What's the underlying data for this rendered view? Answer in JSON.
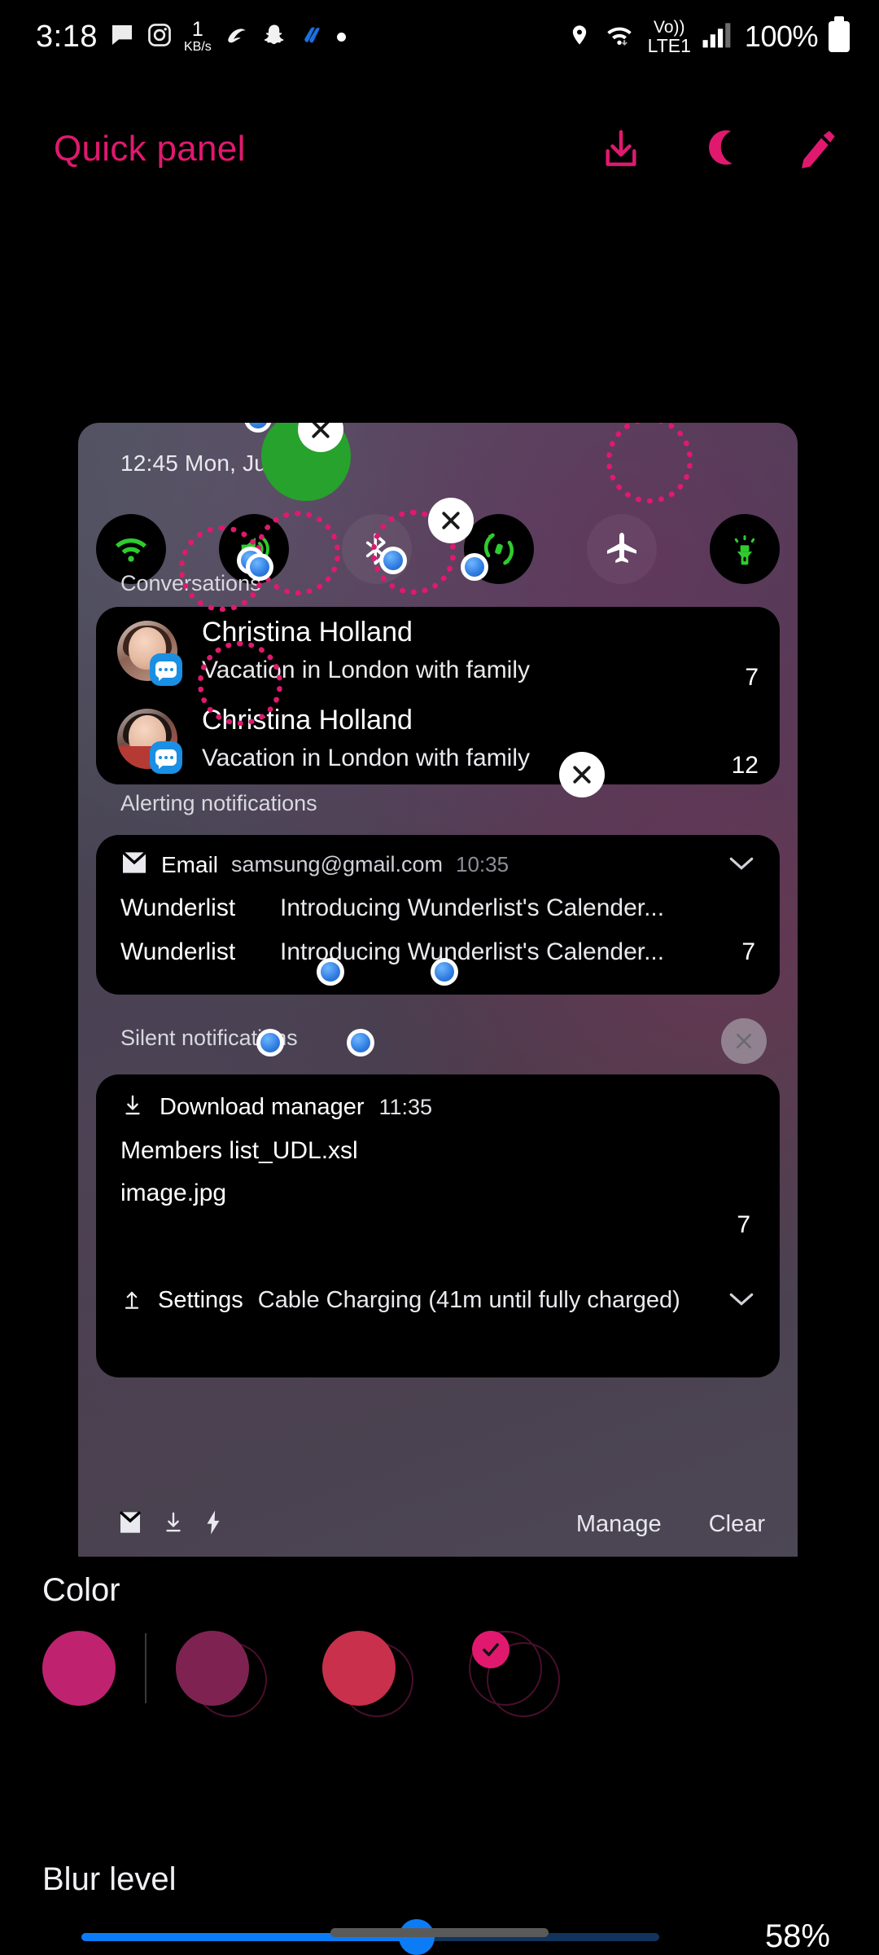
{
  "status_bar": {
    "time": "3:18",
    "left_icons": [
      "messages-icon",
      "instagram-icon",
      "data-speed-icon",
      "airtel-icon",
      "snapchat-icon",
      "jio-icon",
      "dot-icon"
    ],
    "data_speed_value": "1",
    "data_speed_unit": "KB/s",
    "right_icons": [
      "location-icon",
      "wifi-icon",
      "volte-icon",
      "signal-icon",
      "battery-icon"
    ],
    "volte_label_top": "Vo))",
    "volte_label_bottom": "LTE1",
    "battery_percent": "100%"
  },
  "app_bar": {
    "title": "Quick panel",
    "accent_color": "#E0196F",
    "actions": [
      {
        "name": "download-icon",
        "label": "Download"
      },
      {
        "name": "moon-icon",
        "label": "Dark mode"
      },
      {
        "name": "pencil-icon",
        "label": "Edit"
      }
    ]
  },
  "preview": {
    "clock": "12:45 Mon, July",
    "toggles": [
      {
        "name": "wifi-toggle",
        "label": "Wi-Fi",
        "state": "on"
      },
      {
        "name": "sound-toggle",
        "label": "Sound",
        "state": "on"
      },
      {
        "name": "bluetooth-toggle",
        "label": "Bluetooth",
        "state": "off"
      },
      {
        "name": "auto-rotate-toggle",
        "label": "Auto rotate",
        "state": "on"
      },
      {
        "name": "airplane-mode-toggle",
        "label": "Airplane mode",
        "state": "off"
      },
      {
        "name": "flashlight-toggle",
        "label": "Flashlight",
        "state": "on"
      }
    ],
    "sections": {
      "conversations_label": "Conversations",
      "alerting_label": "Alerting notifications",
      "silent_label": "Silent notifications"
    },
    "conversations": [
      {
        "name": "Christina Holland",
        "message": "Vacation in London with family",
        "count": "7"
      },
      {
        "name": "Christina Holland",
        "message": "Vacation in London with family",
        "count": "12"
      }
    ],
    "email": {
      "app": "Email",
      "account": "samsung@gmail.com",
      "time": "10:35",
      "rows": [
        {
          "sender": "Wunderlist",
          "subject": "Introducing Wunderlist's Calender...",
          "count": ""
        },
        {
          "sender": "Wunderlist",
          "subject": "Introducing Wunderlist's Calender...",
          "count": "7"
        }
      ]
    },
    "silent": {
      "download": {
        "app": "Download manager",
        "time": "11:35",
        "files": [
          "Members list_UDL.xsl",
          "image.jpg"
        ],
        "count": "7"
      },
      "settings": {
        "app": "Settings",
        "text": "Cable Charging (41m until fully charged)"
      }
    },
    "footer": {
      "icons": [
        "email-icon",
        "download-icon",
        "charging-icon"
      ],
      "manage_label": "Manage",
      "clear_label": "Clear"
    }
  },
  "color_section": {
    "title": "Color",
    "selected_index": 3,
    "swatches": [
      {
        "name": "swatch-magenta",
        "color": "#BF2370"
      },
      {
        "name": "swatch-plum",
        "color": "#7E2351"
      },
      {
        "name": "swatch-crimson",
        "color": "#C8304B"
      },
      {
        "name": "swatch-transparent",
        "color": "transparent"
      }
    ]
  },
  "blur_section": {
    "title": "Blur level",
    "value_label": "58%",
    "value": 58,
    "min": 0,
    "max": 100,
    "accent_color": "#0b7cf5"
  },
  "nav": {
    "home_indicator": "home-indicator"
  }
}
